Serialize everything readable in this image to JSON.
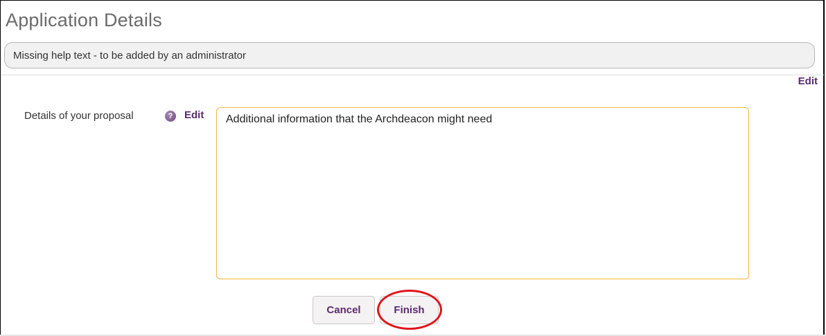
{
  "page": {
    "title": "Application Details",
    "help_text": "Missing help text - to be added by an administrator",
    "edit_link": "Edit"
  },
  "form": {
    "proposal_label": "Details of your proposal",
    "help_icon_glyph": "?",
    "edit_link": "Edit",
    "proposal_value": "Additional information that the Archdeacon might need"
  },
  "actions": {
    "cancel_label": "Cancel",
    "finish_label": "Finish"
  },
  "colors": {
    "accent_purple": "#5b2a6e",
    "field_border": "#f0b63e",
    "annotation_red": "#e0151b"
  }
}
